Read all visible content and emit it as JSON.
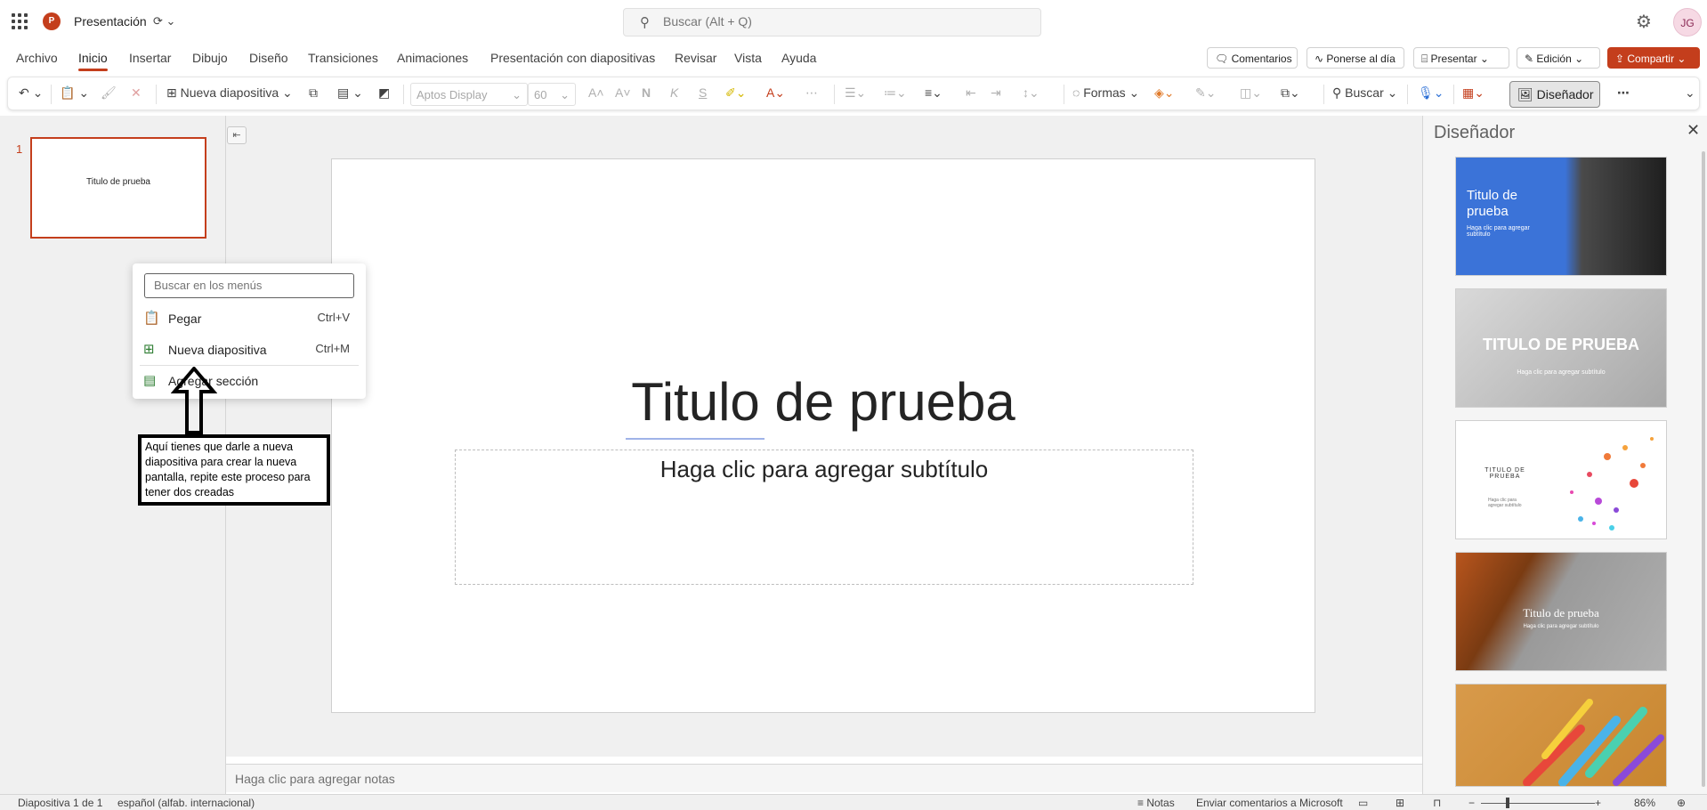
{
  "app": {
    "title": "Presentación",
    "logo_letter": "P",
    "status_icon": "autosave-icon",
    "search_placeholder": "Buscar (Alt + Q)",
    "avatar_initials": "JG"
  },
  "menu": {
    "tabs": [
      "Archivo",
      "Inicio",
      "Insertar",
      "Dibujo",
      "Diseño",
      "Transiciones",
      "Animaciones",
      "Presentación con diapositivas",
      "Revisar",
      "Vista",
      "Ayuda"
    ],
    "active_tab": "Inicio",
    "comments": "Comentarios",
    "catch_up": "Ponerse al día",
    "present": "Presentar",
    "editing": "Edición",
    "share": "Compartir"
  },
  "ribbon": {
    "new_slide": "Nueva diapositiva",
    "font_name": "Aptos Display",
    "font_size": "60",
    "shapes": "Formas",
    "find": "Buscar",
    "designer": "Diseñador"
  },
  "thumbnails": [
    {
      "number": "1",
      "title": "Titulo de prueba"
    }
  ],
  "slide": {
    "title": "Titulo de prueba",
    "subtitle": "Haga clic para agregar subtítulo"
  },
  "notes_placeholder": "Haga clic para agregar notas",
  "designer_pane": {
    "title": "Diseñador",
    "designs": [
      {
        "title": "Titulo de prueba",
        "subtitle": "Haga clic para agregar subtítulo"
      },
      {
        "title": "TITULO DE PRUEBA",
        "subtitle": "Haga clic para agregar subtítulo"
      },
      {
        "title": "TITULO DE PRUEBA",
        "subtitle": "Haga clic para agregar subtítulo"
      },
      {
        "title": "Titulo de prueba",
        "subtitle": "Haga clic para agregar subtítulo"
      }
    ]
  },
  "context_menu": {
    "search_placeholder": "Buscar en los menús",
    "items": [
      {
        "label": "Pegar",
        "shortcut": "Ctrl+V"
      },
      {
        "label": "Nueva diapositiva",
        "shortcut": "Ctrl+M"
      },
      {
        "label": "Agregar sección",
        "shortcut": ""
      }
    ]
  },
  "annotation": "Aquí tienes que darle a nueva diapositiva para crear la nueva pantalla, repite este proceso para tener dos creadas",
  "statusbar": {
    "slide_count": "Diapositiva 1 de 1",
    "language": "español (alfab. internacional)",
    "notes": "Notas",
    "feedback": "Enviar comentarios a Microsoft",
    "zoom": "86%"
  },
  "colors": {
    "accent": "#c43e1c",
    "designer_blue": "#3b73d8"
  }
}
